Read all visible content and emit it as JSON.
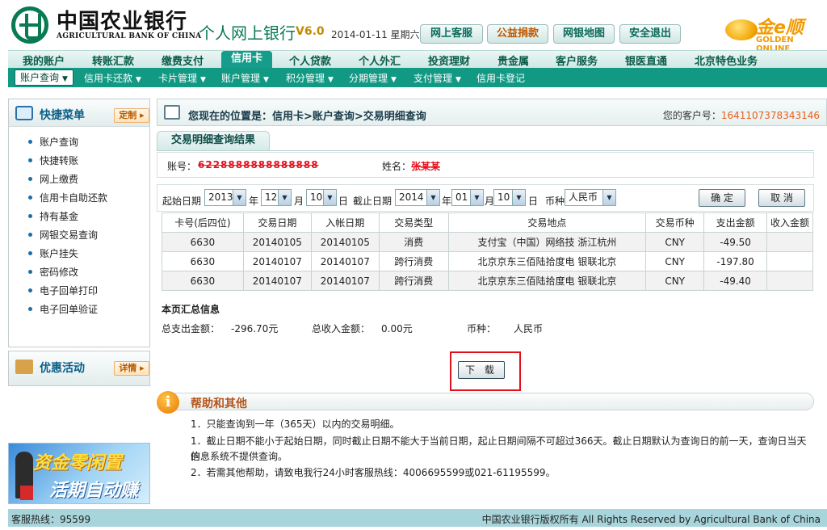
{
  "header": {
    "bank_cn": "中国农业银行",
    "bank_en": "AGRICULTURAL BANK OF CHINA",
    "site_title": "个人网上银行",
    "version": "V6.0",
    "date": "2014-01-11 星期六",
    "buttons": [
      "网上客服",
      "公益捐款",
      "网银地图",
      "安全退出"
    ],
    "brand_cn": "金e顺",
    "brand_en": "GOLDEN ONLINE"
  },
  "main_nav": [
    "我的账户",
    "转账汇款",
    "缴费支付",
    "信用卡",
    "个人贷款",
    "个人外汇",
    "投资理财",
    "贵金属",
    "客户服务",
    "银医直通",
    "北京特色业务"
  ],
  "main_nav_active": "信用卡",
  "sub_nav": [
    "账户查询",
    "信用卡还款",
    "卡片管理",
    "账户管理",
    "积分管理",
    "分期管理",
    "支付管理",
    "信用卡登记"
  ],
  "sidebar": {
    "title": "快捷菜单",
    "tag": "定制",
    "items": [
      "账户查询",
      "快捷转账",
      "网上缴费",
      "信用卡自助还款",
      "持有基金",
      "网银交易查询",
      "账户挂失",
      "密码修改",
      "电子回单打印",
      "电子回单验证"
    ],
    "promo_title": "优惠活动",
    "promo_tag": "详情",
    "banner_line1": "资金零闲置",
    "banner_line2": "活期自动赚"
  },
  "breadcrumb": {
    "text": "您现在的位置是：信用卡>账户查询>交易明细查询",
    "customer_label": "您的客户号：",
    "customer_no": "1641107378343146"
  },
  "result": {
    "tab": "交易明细查询结果",
    "account_label": "账号：",
    "account_value": "6228888888888888",
    "name_label": "姓名：",
    "name_value": "张某某"
  },
  "query": {
    "start_label": "起始日期",
    "start_year": "2013",
    "start_month": "12",
    "start_day": "10",
    "end_label": "截止日期",
    "end_year": "2014",
    "end_month": "01",
    "end_day": "10",
    "year_unit": "年",
    "month_unit": "月",
    "day_unit": "日",
    "currency_label": "币种",
    "currency_value": "人民币",
    "confirm": "确 定",
    "cancel": "取 消"
  },
  "table": {
    "headers": [
      "卡号(后四位)",
      "交易日期",
      "入帐日期",
      "交易类型",
      "交易地点",
      "交易币种",
      "支出金额",
      "收入金额"
    ],
    "rows": [
      [
        "6630",
        "20140105",
        "20140105",
        "消费",
        "支付宝（中国）网络技 浙江杭州",
        "CNY",
        "-49.50",
        ""
      ],
      [
        "6630",
        "20140107",
        "20140107",
        "跨行消费",
        "北京京东三佰陆拾度电 银联北京",
        "CNY",
        "-197.80",
        ""
      ],
      [
        "6630",
        "20140107",
        "20140107",
        "跨行消费",
        "北京京东三佰陆拾度电 银联北京",
        "CNY",
        "-49.40",
        ""
      ]
    ]
  },
  "summary": {
    "title": "本页汇总信息",
    "total_out_label": "总支出金额：",
    "total_out": "-296.70元",
    "total_in_label": "总收入金额：",
    "total_in": "0.00元",
    "currency_label": "币种：",
    "currency": "人民币"
  },
  "download": "下 载",
  "help": {
    "title": "帮助和其他",
    "lines": [
      "1．只能查询到一年（365天）以内的交易明细。",
      "1．截止日期不能小于起始日期，同时截止日期不能大于当前日期，起止日期间隔不可超过366天。截止日期默认为查询日的前一天，查询日当天的",
      "信息系统不提供查询。",
      "2．若需其他帮助，请致电我行24小时客服热线：4006695599或021-61195599。"
    ]
  },
  "footer": {
    "hotline": "客服热线：95599",
    "copyright": "中国农业银行版权所有  All Rights Reserved by Agricultural Bank of China"
  }
}
